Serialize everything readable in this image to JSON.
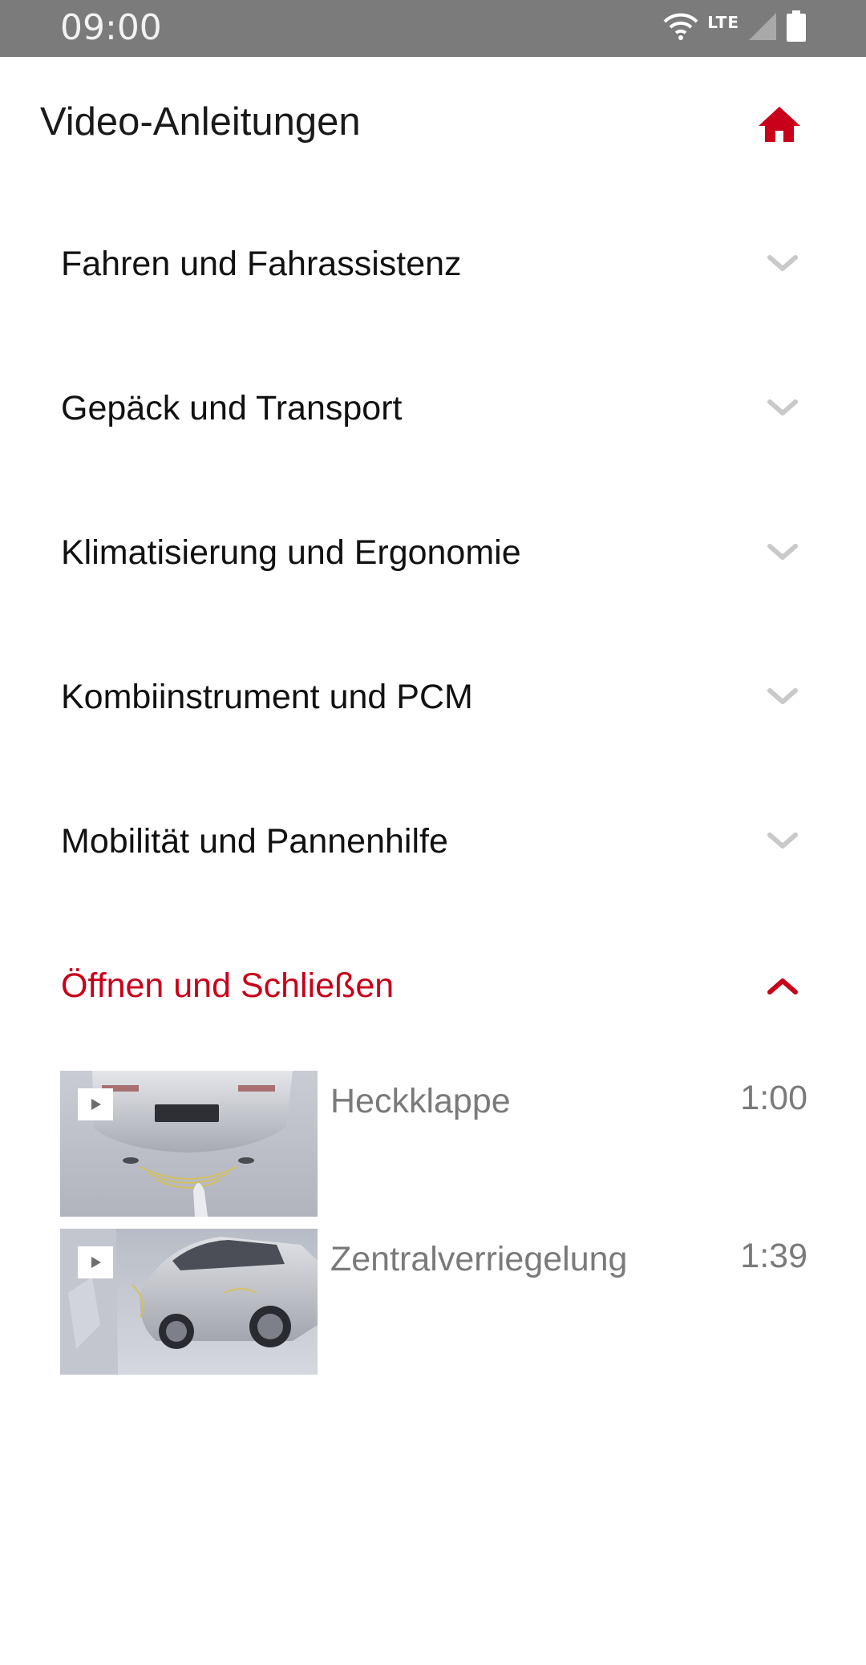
{
  "status_bar": {
    "time": "09:00",
    "network": "LTE",
    "icons": [
      "wifi-icon",
      "cell-signal-icon",
      "battery-icon"
    ]
  },
  "header": {
    "title": "Video-Anleitungen",
    "home_icon": "home-icon"
  },
  "categories": [
    {
      "label": "Fahren und Fahrassistenz",
      "expanded": false
    },
    {
      "label": "Gepäck und Transport",
      "expanded": false
    },
    {
      "label": "Klimatisierung und Ergonomie",
      "expanded": false
    },
    {
      "label": "Kombiinstrument und PCM",
      "expanded": false
    },
    {
      "label": "Mobilität und Pannenhilfe",
      "expanded": false
    },
    {
      "label": "Öffnen und Schließen",
      "expanded": true
    }
  ],
  "videos": [
    {
      "title": "Heckklappe",
      "duration": "1:00",
      "icon": "play-icon"
    },
    {
      "title": "Zentralverriegelung",
      "duration": "1:39",
      "icon": "play-icon"
    }
  ],
  "colors": {
    "accent": "#c8001a",
    "status_bar": "#7b7b7b",
    "chevron_collapsed": "#c9c9c9",
    "secondary_text": "#7a7a7a"
  }
}
